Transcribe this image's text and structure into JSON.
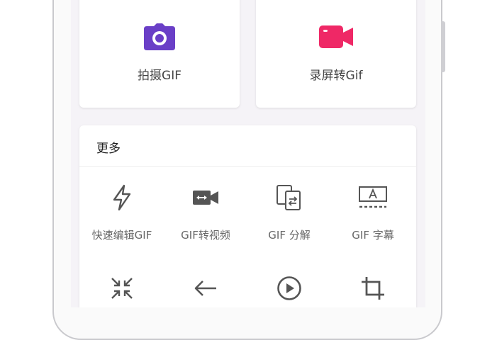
{
  "colors": {
    "shoot_icon": "#6a3fc7",
    "record_icon": "#ef2866",
    "tool_icon": "#555555",
    "label_text": "#666666"
  },
  "top_cards": [
    {
      "label": "拍摄GIF",
      "icon": "camera-icon"
    },
    {
      "label": "录屏转Gif",
      "icon": "video-camera-icon"
    }
  ],
  "more": {
    "title": "更多",
    "tools": [
      {
        "label": "快速编辑GIF",
        "icon": "lightning-icon"
      },
      {
        "label": "GIF转视频",
        "icon": "gif-to-video-icon"
      },
      {
        "label": "GIF 分解",
        "icon": "split-frames-icon"
      },
      {
        "label": "GIF 字幕",
        "icon": "subtitle-icon"
      },
      {
        "label": "",
        "icon": "compress-icon"
      },
      {
        "label": "",
        "icon": "arrow-left-icon"
      },
      {
        "label": "",
        "icon": "play-circle-icon"
      },
      {
        "label": "",
        "icon": "crop-icon"
      }
    ]
  }
}
